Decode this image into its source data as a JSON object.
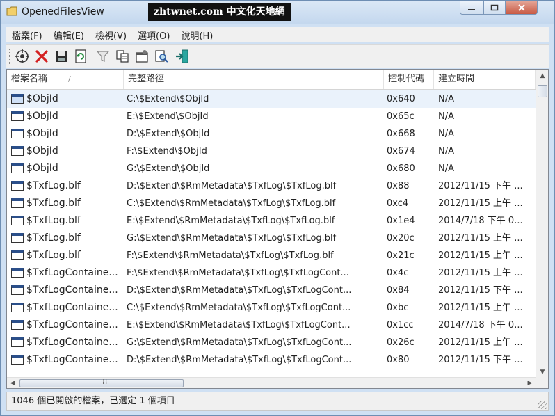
{
  "window": {
    "title": "OpenedFilesView",
    "watermark": "zhtwnet.com 中文化天地網"
  },
  "menu": [
    "檔案(F)",
    "編輯(E)",
    "檢視(V)",
    "選項(O)",
    "說明(H)"
  ],
  "toolbar": [
    "properties-target-icon",
    "close-handle-icon",
    "save-icon",
    "refresh-icon",
    "filter-icon",
    "copy-icon",
    "options-icon",
    "find-icon",
    "exit-icon"
  ],
  "columns": {
    "name": "檔案名稱",
    "name_sort": "/",
    "path": "完整路徑",
    "handle": "控制代碼",
    "time": "建立時間"
  },
  "rows": [
    {
      "name": "$ObjId",
      "path": "C:\\$Extend\\$ObjId",
      "handle": "0x640",
      "time": "N/A"
    },
    {
      "name": "$ObjId",
      "path": "E:\\$Extend\\$ObjId",
      "handle": "0x65c",
      "time": "N/A"
    },
    {
      "name": "$ObjId",
      "path": "D:\\$Extend\\$ObjId",
      "handle": "0x668",
      "time": "N/A"
    },
    {
      "name": "$ObjId",
      "path": "F:\\$Extend\\$ObjId",
      "handle": "0x674",
      "time": "N/A"
    },
    {
      "name": "$ObjId",
      "path": "G:\\$Extend\\$ObjId",
      "handle": "0x680",
      "time": "N/A"
    },
    {
      "name": "$TxfLog.blf",
      "path": "D:\\$Extend\\$RmMetadata\\$TxfLog\\$TxfLog.blf",
      "handle": "0x88",
      "time": "2012/11/15 下午 ..."
    },
    {
      "name": "$TxfLog.blf",
      "path": "C:\\$Extend\\$RmMetadata\\$TxfLog\\$TxfLog.blf",
      "handle": "0xc4",
      "time": "2012/11/15 上午 ..."
    },
    {
      "name": "$TxfLog.blf",
      "path": "E:\\$Extend\\$RmMetadata\\$TxfLog\\$TxfLog.blf",
      "handle": "0x1e4",
      "time": "2014/7/18 下午 0..."
    },
    {
      "name": "$TxfLog.blf",
      "path": "G:\\$Extend\\$RmMetadata\\$TxfLog\\$TxfLog.blf",
      "handle": "0x20c",
      "time": "2012/11/15 上午 ..."
    },
    {
      "name": "$TxfLog.blf",
      "path": "F:\\$Extend\\$RmMetadata\\$TxfLog\\$TxfLog.blf",
      "handle": "0x21c",
      "time": "2012/11/15 上午 ..."
    },
    {
      "name": "$TxfLogContaine...",
      "path": "F:\\$Extend\\$RmMetadata\\$TxfLog\\$TxfLogCont...",
      "handle": "0x4c",
      "time": "2012/11/15 上午 ..."
    },
    {
      "name": "$TxfLogContaine...",
      "path": "D:\\$Extend\\$RmMetadata\\$TxfLog\\$TxfLogCont...",
      "handle": "0x84",
      "time": "2012/11/15 下午 ..."
    },
    {
      "name": "$TxfLogContaine...",
      "path": "C:\\$Extend\\$RmMetadata\\$TxfLog\\$TxfLogCont...",
      "handle": "0xbc",
      "time": "2012/11/15 上午 ..."
    },
    {
      "name": "$TxfLogContaine...",
      "path": "E:\\$Extend\\$RmMetadata\\$TxfLog\\$TxfLogCont...",
      "handle": "0x1cc",
      "time": "2014/7/18 下午 0..."
    },
    {
      "name": "$TxfLogContaine...",
      "path": "G:\\$Extend\\$RmMetadata\\$TxfLog\\$TxfLogCont...",
      "handle": "0x26c",
      "time": "2012/11/15 上午 ..."
    },
    {
      "name": "$TxfLogContaine...",
      "path": "D:\\$Extend\\$RmMetadata\\$TxfLog\\$TxfLogCont...",
      "handle": "0x80",
      "time": "2012/11/15 下午 ..."
    }
  ],
  "selected_row": 0,
  "status": "1046 個已開啟的檔案，已選定 1 個項目"
}
